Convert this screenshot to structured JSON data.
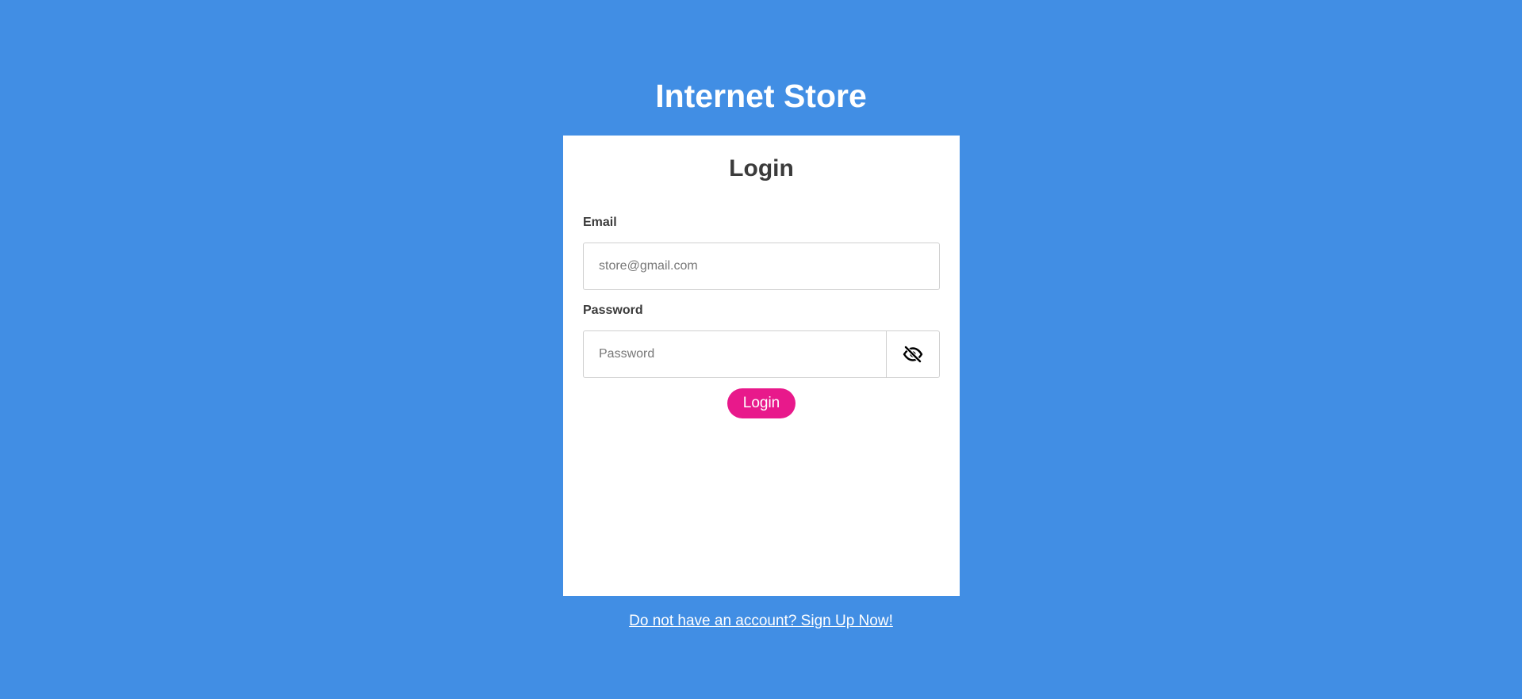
{
  "app": {
    "title": "Internet Store"
  },
  "login_card": {
    "heading": "Login",
    "email": {
      "label": "Email",
      "value": "",
      "placeholder": "store@gmail.com"
    },
    "password": {
      "label": "Password",
      "value": "",
      "placeholder": "Password",
      "toggle_icon": "eye-slash-icon"
    },
    "submit_label": "Login"
  },
  "signup_link": {
    "text": "Do not have an account? Sign Up Now!"
  },
  "colors": {
    "background": "#418ee4",
    "card": "#ffffff",
    "accent": "#e8198b",
    "text": "#3b3b3b"
  }
}
